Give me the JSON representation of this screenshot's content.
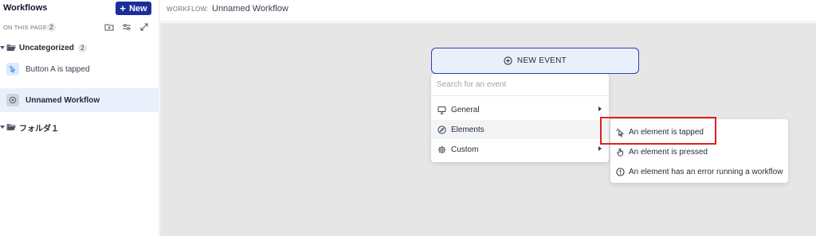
{
  "sidebar": {
    "title": "Workflows",
    "new_button": {
      "icon": "plus-icon",
      "label": "New"
    },
    "on_this_page": {
      "label": "ON THIS PAGE",
      "count": "2"
    },
    "toolbar_icons": [
      "new-folder-icon",
      "filter-sliders-icon",
      "expand-icon"
    ],
    "folders": [
      {
        "label": "Uncategorized",
        "count": "2",
        "icon": "folder-open-icon"
      },
      {
        "label": "フォルダ１",
        "icon": "folder-open-icon"
      }
    ],
    "workflows": [
      {
        "label": "Button A is tapped",
        "icon": "tap-pointer-icon",
        "selected": false
      },
      {
        "label": "Unnamed Workflow",
        "icon": "plus-circle-icon",
        "selected": true
      }
    ]
  },
  "header": {
    "prefix": "WORKFLOW:",
    "name": "Unnamed Workflow"
  },
  "canvas": {
    "new_event_label": "NEW EVENT",
    "new_event_icon": "plus-circle-icon",
    "search_placeholder": "Search for an event",
    "menu_items": [
      {
        "label": "General",
        "icon": "monitor-icon",
        "has_submenu": true
      },
      {
        "label": "Elements",
        "icon": "compass-icon",
        "has_submenu": false,
        "hovered": true
      },
      {
        "label": "Custom",
        "icon": "gear-icon",
        "has_submenu": true
      }
    ],
    "submenu_items": [
      {
        "label": "An element is tapped",
        "icon": "tap-pointer-icon",
        "highlighted": true
      },
      {
        "label": "An element is pressed",
        "icon": "hand-pointer-icon"
      },
      {
        "label": "An element has an error running a workflow",
        "icon": "exclamation-circle-icon"
      }
    ]
  },
  "colors": {
    "brand": "#1a2d9c",
    "new_event_border": "#2e3fb3",
    "canvas_bg": "#e6e6e6",
    "selected_bg": "#eaf0fb",
    "highlight": "#e02020"
  }
}
